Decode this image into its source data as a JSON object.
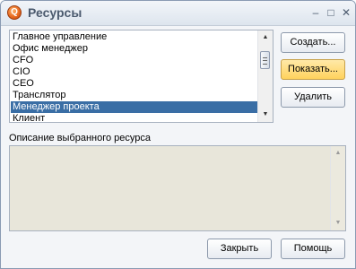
{
  "window": {
    "title": "Ресурсы",
    "app_icon_letter": "Q"
  },
  "resources": {
    "items": [
      "Главное управление",
      "Офис менеджер",
      "CFO",
      "CIO",
      "CEO",
      "Транслятор",
      "Менеджер проекта",
      "Клиент"
    ],
    "selected_index": 6
  },
  "buttons": {
    "create": "Создать...",
    "show": "Показать...",
    "delete": "Удалить",
    "close": "Закрыть",
    "help": "Помощь"
  },
  "description": {
    "label": "Описание выбранного ресурса",
    "text": ""
  },
  "icons": {
    "minimize": "minimize-icon",
    "maximize": "maximize-icon",
    "close": "close-icon",
    "scroll_up": "chevron-up-icon",
    "scroll_down": "chevron-down-icon"
  },
  "colors": {
    "selection": "#3a6ea5",
    "highlight_button": "#ffd25d"
  }
}
